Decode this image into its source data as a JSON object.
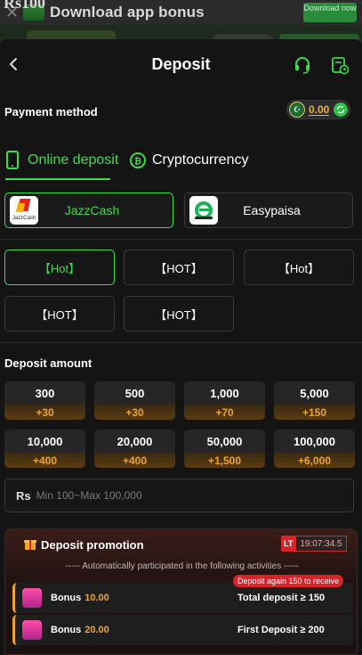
{
  "banner": {
    "close": "✕",
    "text": "Download app bonus",
    "amount": "Rs100",
    "download_button": "Download now"
  },
  "header": {
    "title": "Deposit"
  },
  "payment": {
    "label": "Payment method",
    "balance": "0.00"
  },
  "tabs": [
    {
      "label": "Online deposit",
      "active": true
    },
    {
      "label": "Cryptocurrency",
      "active": false
    }
  ],
  "methods": [
    {
      "name": "JazzCash",
      "logo_text": "JazzCash",
      "selected": true
    },
    {
      "name": "Easypaisa",
      "selected": false
    }
  ],
  "channels": [
    {
      "label": "【Hot】",
      "selected": true
    },
    {
      "label": "【HOT】",
      "selected": false
    },
    {
      "label": "【Hot】",
      "selected": false
    },
    {
      "label": "【HOT】",
      "selected": false
    },
    {
      "label": "【HOT】",
      "selected": false
    }
  ],
  "deposit_amount": {
    "label": "Deposit amount",
    "options": [
      {
        "amount": "300",
        "bonus": "+30"
      },
      {
        "amount": "500",
        "bonus": "+30"
      },
      {
        "amount": "1,000",
        "bonus": "+70"
      },
      {
        "amount": "5,000",
        "bonus": "+150"
      },
      {
        "amount": "10,000",
        "bonus": "+400"
      },
      {
        "amount": "20,000",
        "bonus": "+400"
      },
      {
        "amount": "50,000",
        "bonus": "+1,500"
      },
      {
        "amount": "100,000",
        "bonus": "+6,000"
      }
    ],
    "currency": "Rs",
    "placeholder": "Min 100~Max 100,000"
  },
  "promotion": {
    "title": "Deposit promotion",
    "timer_tag": "LT",
    "timer": "19:07:34.5",
    "auto_text": "----- Automatically participated in the following activities -----",
    "activities": [
      {
        "bonus_label": "Bonus",
        "bonus_value": "10.00",
        "condition": "Total deposit ≥ 150",
        "tip": "Deposit again 150 to receive"
      },
      {
        "bonus_label": "Bonus",
        "bonus_value": "20.00",
        "condition": "First Deposit ≥ 200",
        "tip": ""
      }
    ]
  },
  "colors": {
    "accent": "#3ddc4a",
    "bonus": "#f0a32b",
    "danger": "#d8232a",
    "background": "#141414"
  }
}
